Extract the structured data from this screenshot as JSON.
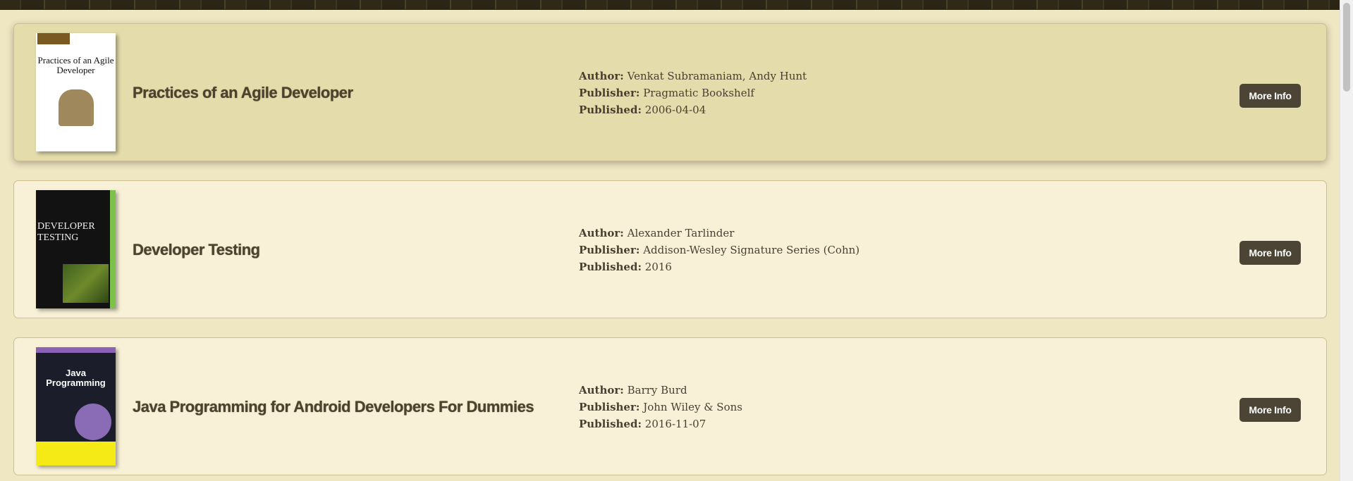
{
  "labels": {
    "author": "Author:",
    "publisher": "Publisher:",
    "published": "Published:",
    "more_info": "More Info"
  },
  "books": [
    {
      "title": "Practices of an Agile Developer",
      "author": "Venkat Subramaniam, Andy Hunt",
      "publisher": "Pragmatic Bookshelf",
      "published": "2006-04-04",
      "cover_icon": "book-cover-image",
      "cover_text": "Practices of an Agile Developer"
    },
    {
      "title": "Developer Testing",
      "author": "Alexander Tarlinder",
      "publisher": "Addison-Wesley Signature Series (Cohn)",
      "published": "2016",
      "cover_icon": "book-cover-image",
      "cover_text": "DEVELOPER TESTING"
    },
    {
      "title": "Java Programming for Android Developers For Dummies",
      "author": "Barry Burd",
      "publisher": "John Wiley & Sons",
      "published": "2016-11-07",
      "cover_icon": "book-cover-image",
      "cover_text": "Java Programming"
    }
  ],
  "colors": {
    "page_bg": "#efe6c2",
    "card_bg": "#f8f1d7",
    "card_hover_bg": "#e4dcab",
    "button_bg": "#4c4535",
    "title_color": "#4c422e"
  }
}
